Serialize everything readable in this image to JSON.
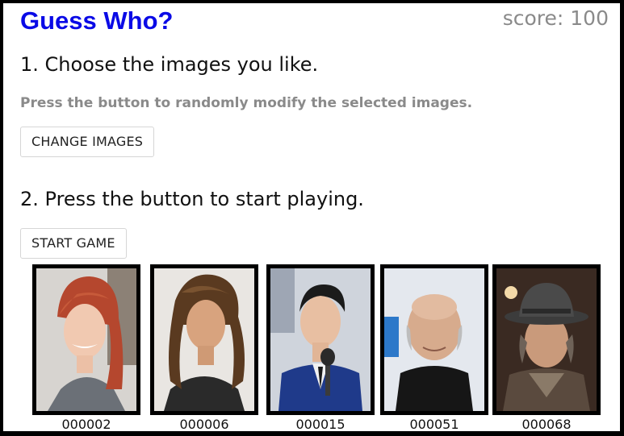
{
  "header": {
    "title": "Guess Who?",
    "score": "score: 100"
  },
  "step1": {
    "text": "1. Choose the images you like.",
    "hint": "Press the button to randomly modify the selected images.",
    "button_label": "CHANGE IMAGES"
  },
  "step2": {
    "text": "2. Press the button to start playing.",
    "button_label": "START GAME"
  },
  "images": [
    {
      "id": "000002"
    },
    {
      "id": "000006"
    },
    {
      "id": "000015"
    },
    {
      "id": "000051"
    },
    {
      "id": "000068"
    }
  ],
  "colors": {
    "title": "#0a0ae6",
    "muted": "#8a8a8a"
  }
}
